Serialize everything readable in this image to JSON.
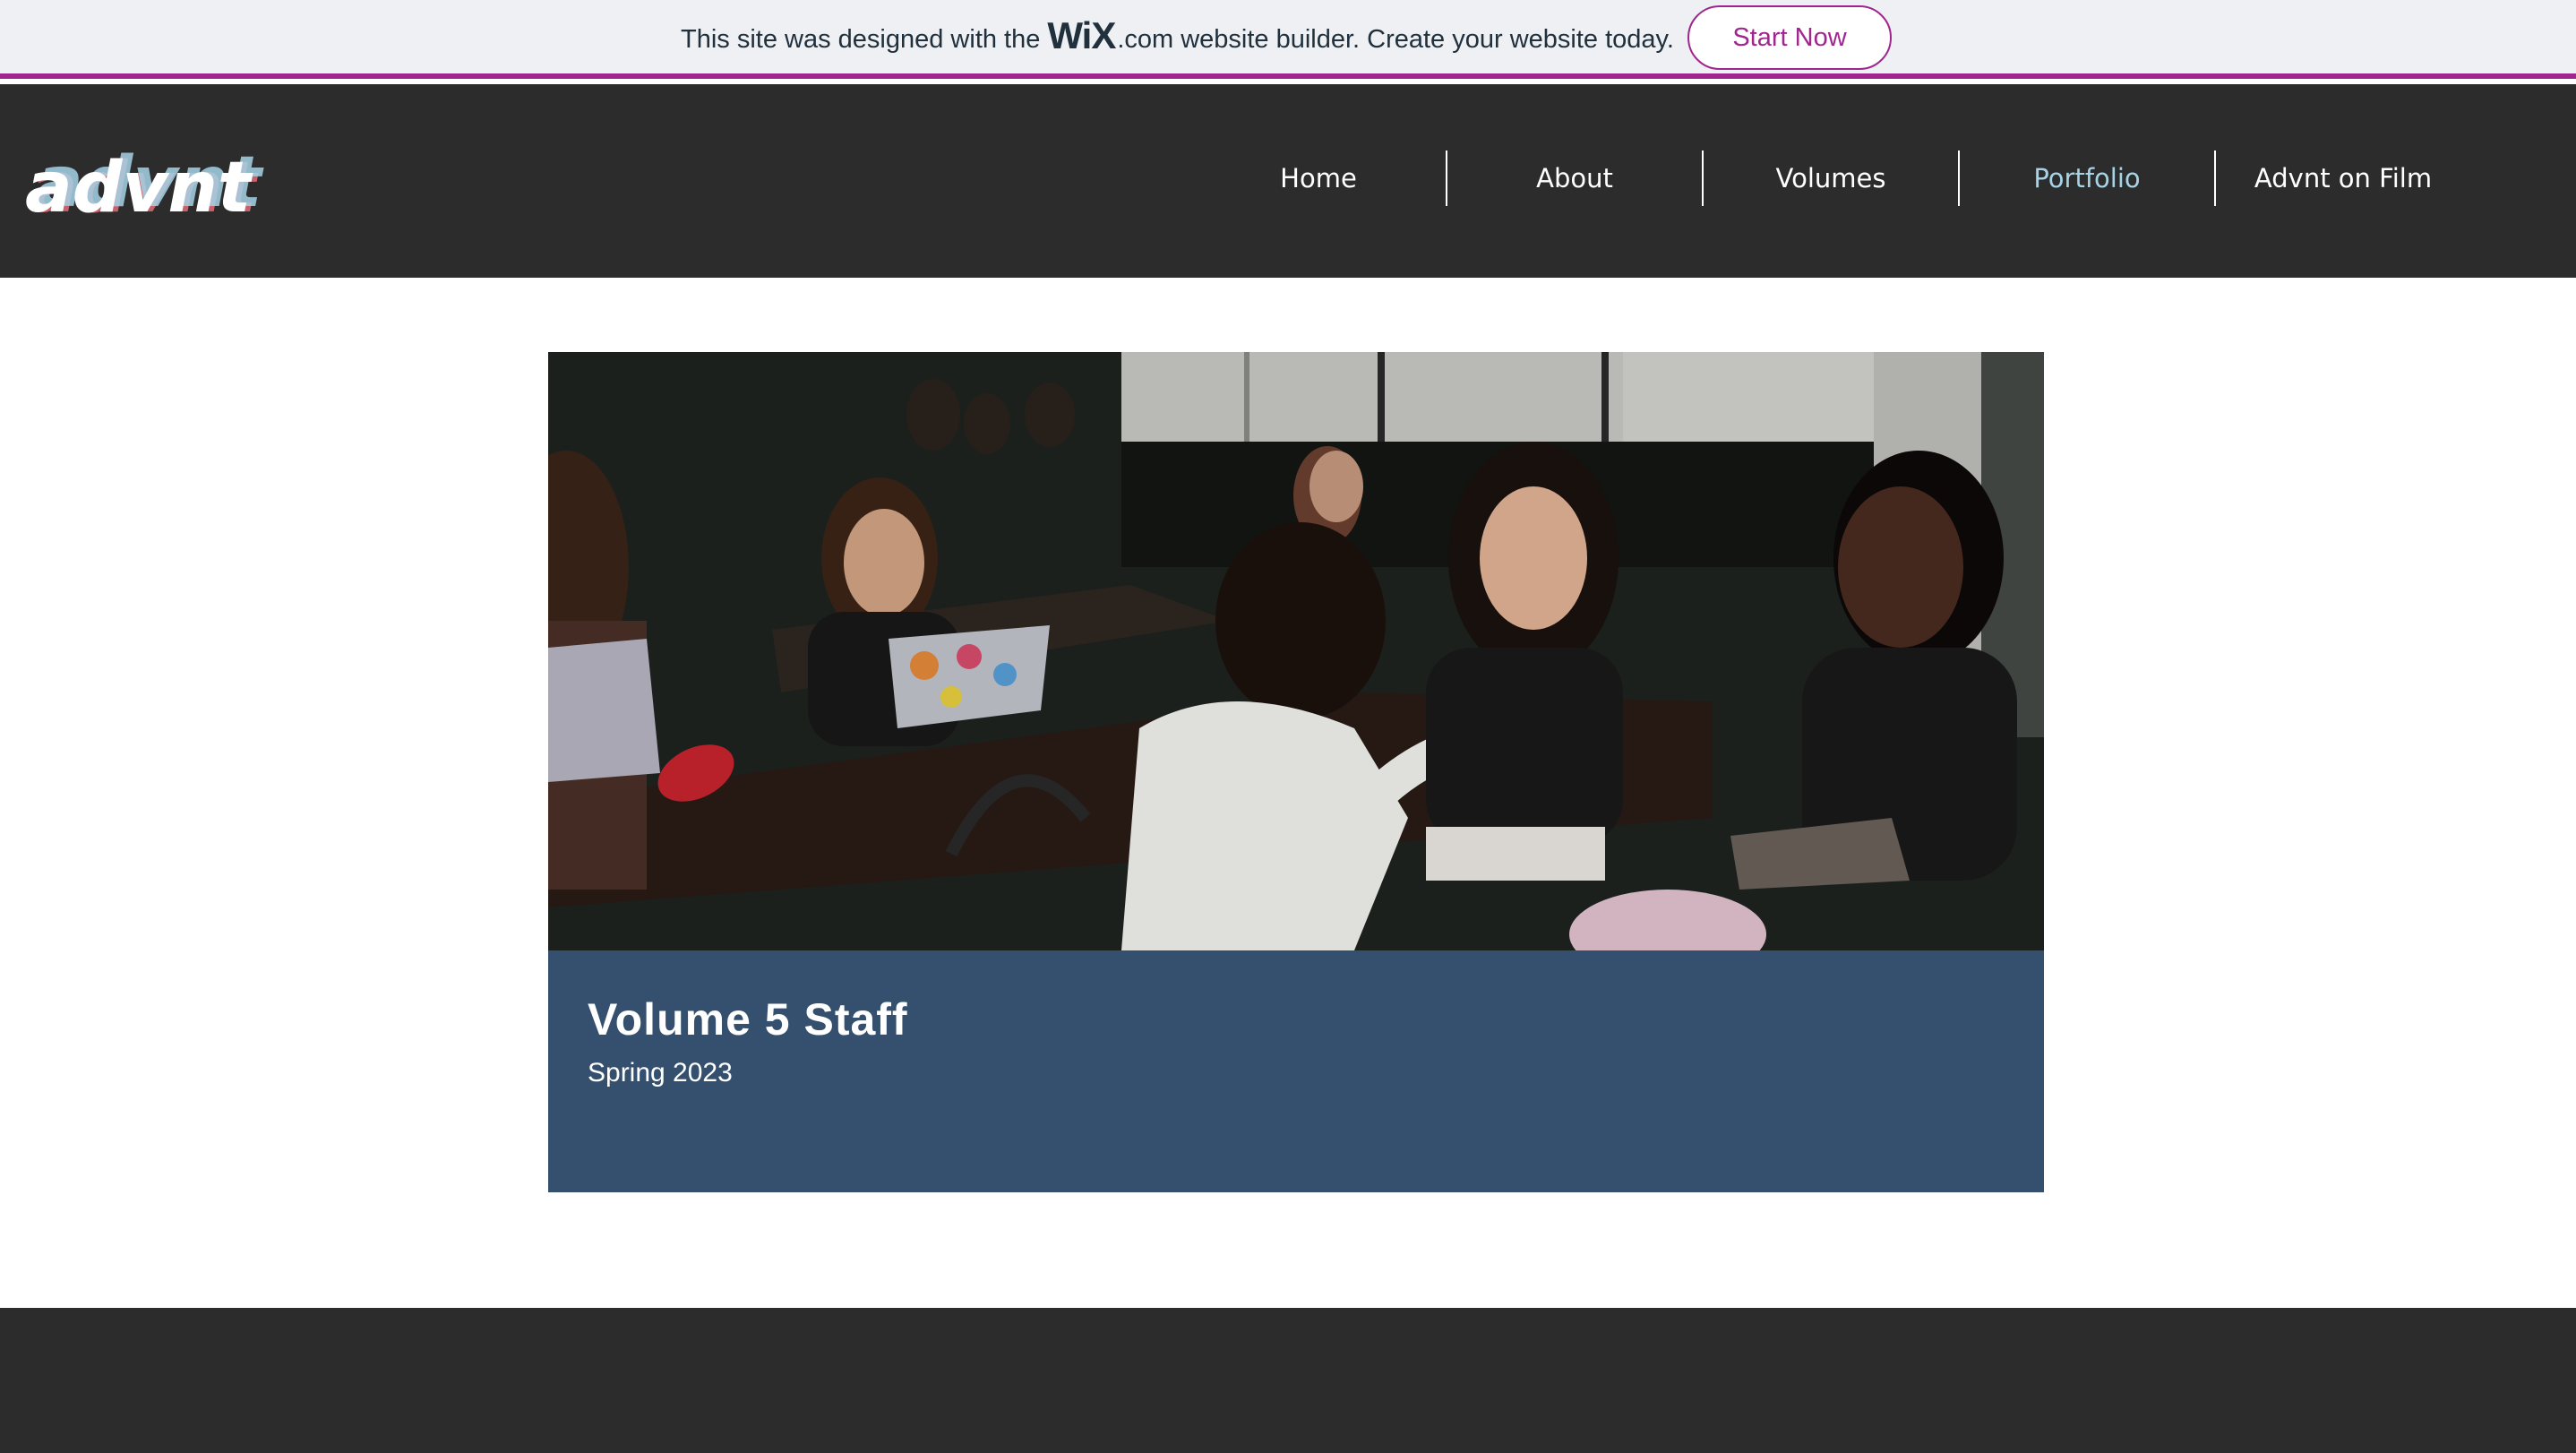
{
  "banner": {
    "text_before": "This site was designed with the",
    "wix_logo": "WiX",
    "wix_dotcom": ".com",
    "text_after": "website builder. Create your website today.",
    "cta_label": "Start Now",
    "accent_color": "#a0268f"
  },
  "header": {
    "logo_text": "advnt",
    "nav": [
      {
        "label": "Home",
        "active": false
      },
      {
        "label": "About",
        "active": false
      },
      {
        "label": "Volumes",
        "active": false
      },
      {
        "label": "Portfolio",
        "active": true
      },
      {
        "label": "Advnt on Film",
        "active": false
      }
    ],
    "background_color": "#2c2c2c",
    "active_color": "#a6d3e6"
  },
  "card": {
    "title": "Volume 5 Staff",
    "subtitle": "Spring 2023",
    "background_color": "#34506e"
  }
}
